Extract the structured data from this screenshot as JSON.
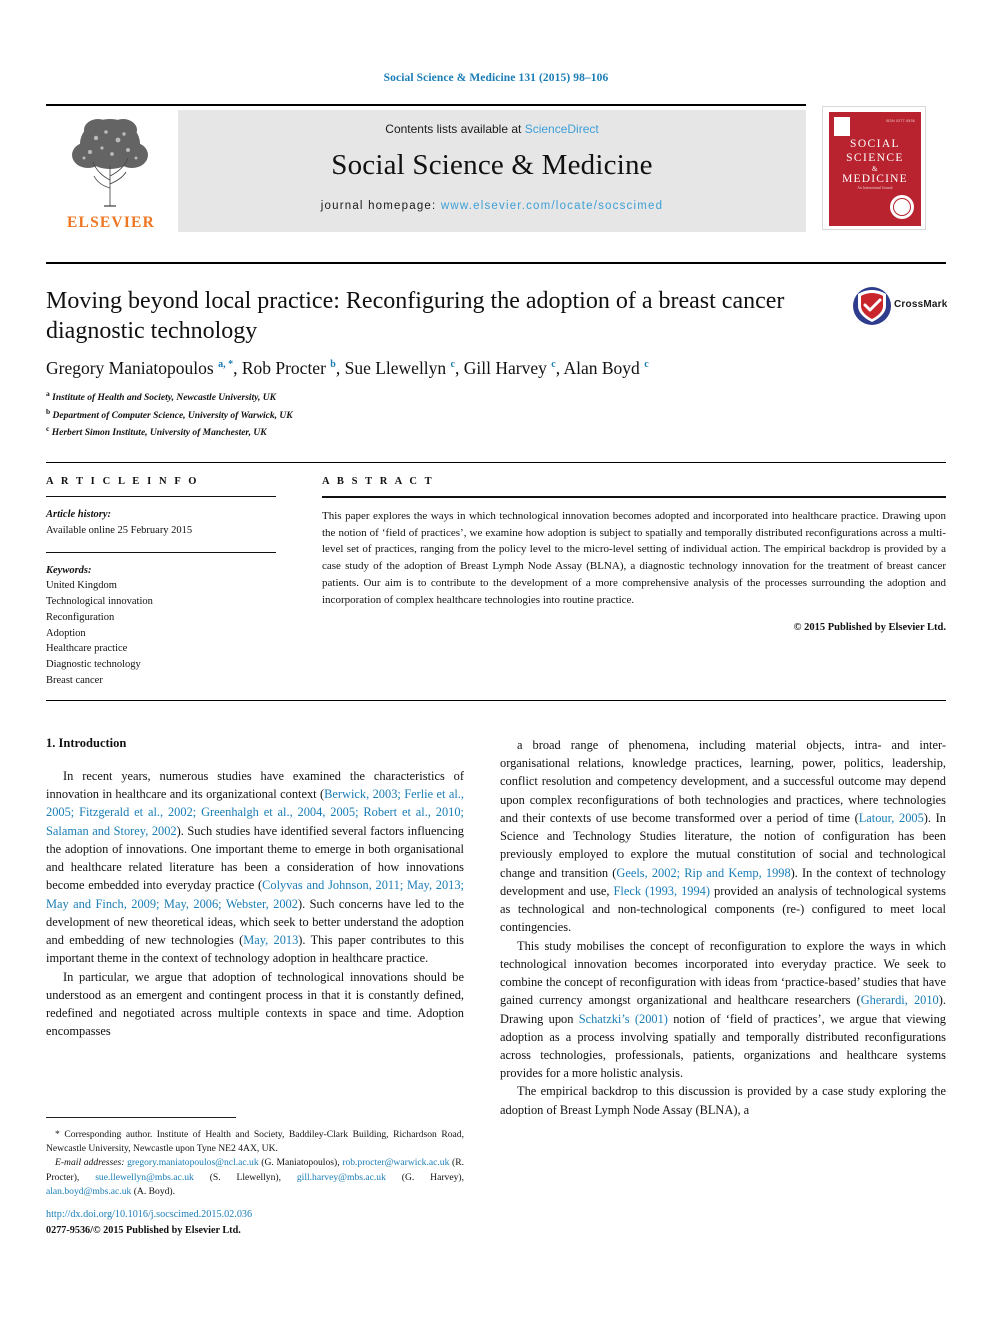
{
  "running_head": "Social Science & Medicine 131 (2015) 98–106",
  "masthead": {
    "contents_prefix": "Contents lists available at ",
    "contents_link": "ScienceDirect",
    "journal_name": "Social Science & Medicine",
    "homepage_prefix": "journal homepage: ",
    "homepage_url": "www.elsevier.com/locate/socscimed",
    "publisher": "ELSEVIER"
  },
  "cover": {
    "line1": "SOCIAL",
    "line2": "SCIENCE",
    "line3": "&",
    "line4": "MEDICINE",
    "subtitle": "An International Journal",
    "corner_text": "ISSN 0277-9536"
  },
  "article": {
    "title": "Moving beyond local practice: Reconfiguring the adoption of a breast cancer diagnostic technology",
    "crossmark_label": "CrossMark",
    "authors": [
      {
        "name": "Gregory Maniatopoulos",
        "marks": "a, *"
      },
      {
        "name": "Rob Procter",
        "marks": "b"
      },
      {
        "name": "Sue Llewellyn",
        "marks": "c"
      },
      {
        "name": "Gill Harvey",
        "marks": "c"
      },
      {
        "name": "Alan Boyd",
        "marks": "c"
      }
    ],
    "affiliations": [
      {
        "mark": "a",
        "text": "Institute of Health and Society, Newcastle University, UK"
      },
      {
        "mark": "b",
        "text": "Department of Computer Science, University of Warwick, UK"
      },
      {
        "mark": "c",
        "text": "Herbert Simon Institute, University of Manchester, UK"
      }
    ]
  },
  "article_info": {
    "heading": "A R T I C L E   I N F O",
    "history_label": "Article history:",
    "history_value": "Available online 25 February 2015",
    "keywords_label": "Keywords:",
    "keywords": [
      "United Kingdom",
      "Technological innovation",
      "Reconfiguration",
      "Adoption",
      "Healthcare practice",
      "Diagnostic technology",
      "Breast cancer"
    ]
  },
  "abstract": {
    "heading": "A B S T R A C T",
    "text": "This paper explores the ways in which technological innovation becomes adopted and incorporated into healthcare practice. Drawing upon the notion of ‘field of practices’, we examine how adoption is subject to spatially and temporally distributed reconfigurations across a multi-level set of practices, ranging from the policy level to the micro-level setting of individual action. The empirical backdrop is provided by a case study of the adoption of Breast Lymph Node Assay (BLNA), a diagnostic technology innovation for the treatment of breast cancer patients. Our aim is to contribute to the development of a more comprehensive analysis of the processes surrounding the adoption and incorporation of complex healthcare technologies into routine practice.",
    "copyright": "© 2015 Published by Elsevier Ltd."
  },
  "body": {
    "section_heading": "1. Introduction",
    "left_paragraphs": [
      {
        "segments": [
          {
            "t": "In recent years, numerous studies have examined the characteristics of innovation in healthcare and its organizational context (",
            "k": "p"
          },
          {
            "t": "Berwick, 2003; Ferlie et al., 2005; Fitzgerald et al., 2002; Greenhalgh et al., 2004, 2005; Robert et al., 2010; Salaman and Storey, 2002",
            "k": "c"
          },
          {
            "t": "). Such studies have identified several factors influencing the adoption of innovations. One important theme to emerge in both organisational and healthcare related literature has been a consideration of how innovations become embedded into everyday practice (",
            "k": "p"
          },
          {
            "t": "Colyvas and Johnson, 2011; May, 2013; May and Finch, 2009; May, 2006; Webster, 2002",
            "k": "c"
          },
          {
            "t": "). Such concerns have led to the development of new theoretical ideas, which seek to better understand the adoption and embedding of new technologies (",
            "k": "p"
          },
          {
            "t": "May, 2013",
            "k": "c"
          },
          {
            "t": "). This paper contributes to this important theme in the context of technology adoption in healthcare practice.",
            "k": "p"
          }
        ]
      },
      {
        "segments": [
          {
            "t": "In particular, we argue that adoption of technological innovations should be understood as an emergent and contingent process in that it is constantly defined, redefined and negotiated across multiple contexts in space and time. Adoption encompasses",
            "k": "p"
          }
        ]
      }
    ],
    "right_paragraphs": [
      {
        "segments": [
          {
            "t": "a broad range of phenomena, including material objects, intra- and inter-organisational relations, knowledge practices, learning, power, politics, leadership, conflict resolution and competency development, and a successful outcome may depend upon complex reconfigurations of both technologies and practices, where technologies and their contexts of use become transformed over a period of time (",
            "k": "p"
          },
          {
            "t": "Latour, 2005",
            "k": "c"
          },
          {
            "t": "). In Science and Technology Studies literature, the notion of configuration has been previously employed to explore the mutual constitution of social and technological change and transition (",
            "k": "p"
          },
          {
            "t": "Geels, 2002; Rip and Kemp, 1998",
            "k": "c"
          },
          {
            "t": "). In the context of technology development and use, ",
            "k": "p"
          },
          {
            "t": "Fleck (1993, 1994)",
            "k": "c"
          },
          {
            "t": " provided an analysis of technological systems as technological and non-technological components (re-) configured to meet local contingencies.",
            "k": "p"
          }
        ]
      },
      {
        "segments": [
          {
            "t": "This study mobilises the concept of reconfiguration to explore the ways in which technological innovation becomes incorporated into everyday practice. We seek to combine the concept of reconfiguration with ideas from ‘practice-based’ studies that have gained currency amongst organizational and healthcare researchers (",
            "k": "p"
          },
          {
            "t": "Gherardi, 2010",
            "k": "c"
          },
          {
            "t": "). Drawing upon ",
            "k": "p"
          },
          {
            "t": "Schatzki’s (2001)",
            "k": "c"
          },
          {
            "t": " notion of ‘field of practices’, we argue that viewing adoption as a process involving spatially and temporally distributed reconfigurations across technologies, professionals, patients, organizations and healthcare systems provides for a more holistic analysis.",
            "k": "p"
          }
        ]
      },
      {
        "segments": [
          {
            "t": "The empirical backdrop to this discussion is provided by a case study exploring the adoption of Breast Lymph Node Assay (BLNA), a",
            "k": "p"
          }
        ]
      }
    ]
  },
  "footnote": {
    "corresponding": "* Corresponding author. Institute of Health and Society, Baddiley-Clark Building, Richardson Road, Newcastle University, Newcastle upon Tyne NE2 4AX, UK.",
    "email_label": "E-mail addresses:",
    "emails": [
      {
        "address": "gregory.maniatopoulos@ncl.ac.uk",
        "person": "(G. Maniatopoulos)"
      },
      {
        "address": "rob.procter@warwick.ac.uk",
        "person": "(R. Procter)"
      },
      {
        "address": "sue.llewellyn@mbs.ac.uk",
        "person": "(S. Llewellyn)"
      },
      {
        "address": "gill.harvey@mbs.ac.uk",
        "person": "(G. Harvey)"
      },
      {
        "address": "alan.boyd@mbs.ac.uk",
        "person": "(A. Boyd)"
      }
    ]
  },
  "doi_url": "http://dx.doi.org/10.1016/j.socscimed.2015.02.036",
  "issn_line": "0277-9536/© 2015 Published by Elsevier Ltd.",
  "colors": {
    "link_blue": "#1a7db6",
    "sciencedirect_blue": "#3d9fd6",
    "elsevier_orange": "#ef7622",
    "cover_red": "#b8232f",
    "mast_gray": "#e6e6e6"
  }
}
